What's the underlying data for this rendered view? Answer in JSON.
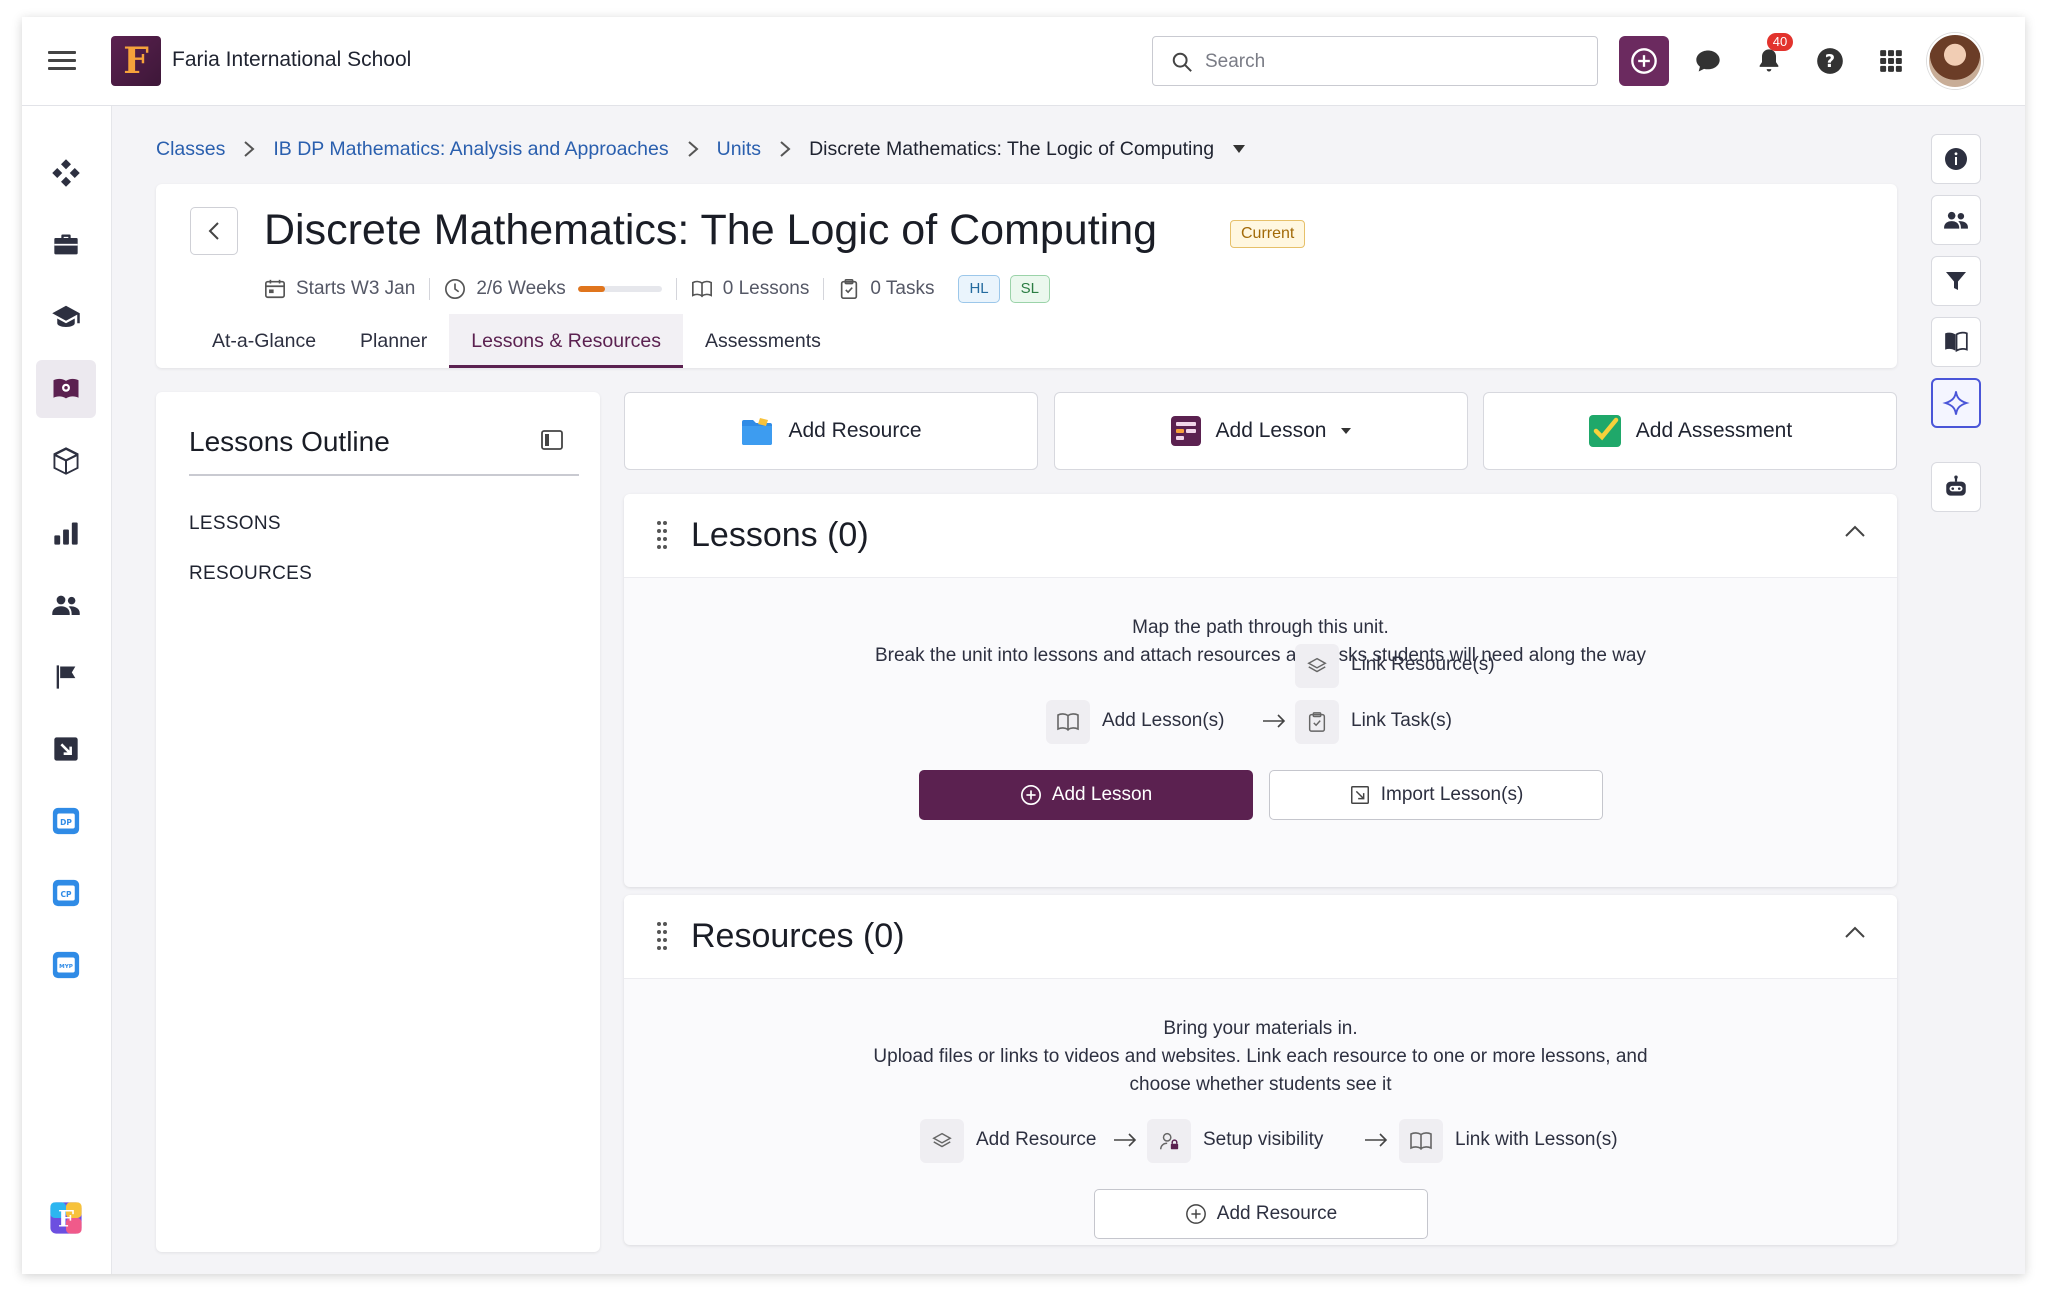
{
  "topbar": {
    "school_name": "Faria International School",
    "logo_letter": "F",
    "search_placeholder": "Search",
    "notification_count": "40",
    "icons": [
      "menu-icon",
      "add-circle-icon",
      "chat-icon",
      "bell-icon",
      "help-icon",
      "apps-grid-icon",
      "user-avatar"
    ]
  },
  "sidebar": {
    "items": [
      "dashboard-icon",
      "briefcase-icon",
      "graduation-cap-icon",
      "curriculum-icon",
      "cube-icon",
      "bar-chart-icon",
      "people-icon",
      "flag-icon",
      "import-icon",
      "dp-calendar-icon",
      "cp-calendar-icon",
      "myp-calendar-icon",
      "faria-apps-icon"
    ],
    "active": "curriculum-icon"
  },
  "right_rail": {
    "items": [
      "info-icon",
      "people-icon",
      "filter-icon",
      "book-icon",
      "ai-sparkle-icon",
      "robot-icon"
    ],
    "active": "ai-sparkle-icon"
  },
  "breadcrumb": {
    "items": [
      "Classes",
      "IB DP Mathematics: Analysis and Approaches",
      "Units"
    ],
    "current": "Discrete Mathematics: The Logic of Computing"
  },
  "unit": {
    "title": "Discrete Mathematics: The Logic of Computing",
    "status": "Current",
    "starts": "Starts W3 Jan",
    "weeks": "2/6 Weeks",
    "weeks_progress": 0.33,
    "lessons_count": "0 Lessons",
    "tasks_count": "0 Tasks",
    "levels": [
      "HL",
      "SL"
    ]
  },
  "tabs": [
    {
      "label": "At-a-Glance",
      "active": false
    },
    {
      "label": "Planner",
      "active": false
    },
    {
      "label": "Lessons & Resources",
      "active": true
    },
    {
      "label": "Assessments",
      "active": false
    }
  ],
  "outline": {
    "title": "Lessons Outline",
    "links": [
      "LESSONS",
      "RESOURCES"
    ]
  },
  "actions": {
    "add_resource": "Add Resource",
    "add_lesson": "Add Lesson",
    "add_assessment": "Add Assessment"
  },
  "lessons_section": {
    "title": "Lessons (0)",
    "desc_line1": "Map the path through this unit.",
    "desc_line2": "Break the unit into lessons and attach resources and tasks students will need along the way",
    "flow": {
      "add_lessons": "Add Lesson(s)",
      "link_resources": "Link Resource(s)",
      "link_tasks": "Link Task(s)"
    },
    "primary_button": "Add Lesson",
    "secondary_button": "Import Lesson(s)"
  },
  "resources_section": {
    "title": "Resources (0)",
    "desc_line1": "Bring your materials in.",
    "desc_line2": "Upload files or links to videos and websites. Link each resource to one or more lessons, and",
    "desc_line3": "choose whether students see it",
    "flow": {
      "add_resource": "Add Resource",
      "setup_visibility": "Setup visibility",
      "link_lessons": "Link with Lesson(s)"
    },
    "button": "Add Resource"
  },
  "colors": {
    "brand": "#5b2150",
    "link": "#2a5fae",
    "progress": "#e0751d",
    "ai_accent": "#4a55d8"
  }
}
